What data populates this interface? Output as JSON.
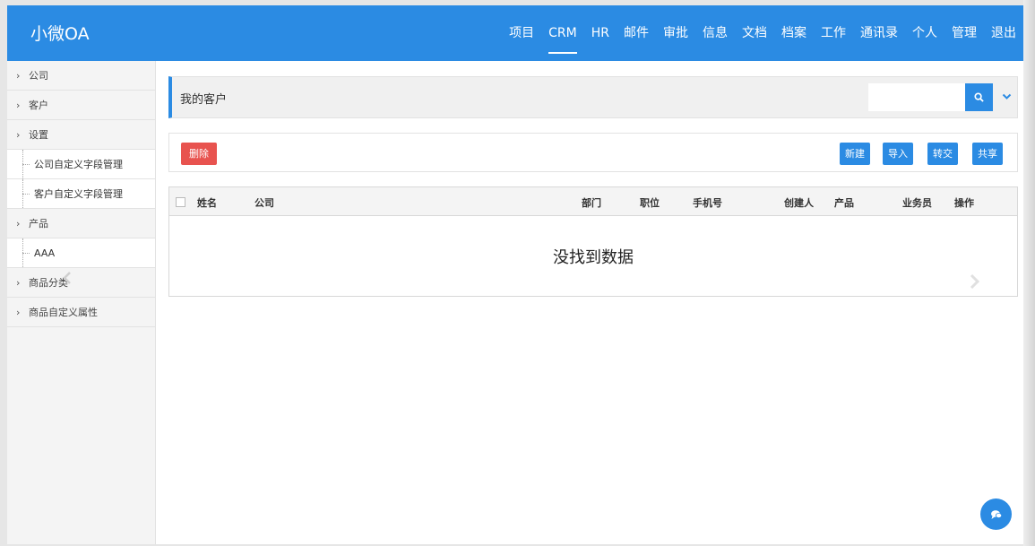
{
  "app": {
    "title": "小微OA"
  },
  "nav": {
    "items": [
      {
        "label": "项目",
        "active": false
      },
      {
        "label": "CRM",
        "active": true
      },
      {
        "label": "HR",
        "active": false
      },
      {
        "label": "邮件",
        "active": false
      },
      {
        "label": "审批",
        "active": false
      },
      {
        "label": "信息",
        "active": false
      },
      {
        "label": "文档",
        "active": false
      },
      {
        "label": "档案",
        "active": false
      },
      {
        "label": "工作",
        "active": false
      },
      {
        "label": "通讯录",
        "active": false
      },
      {
        "label": "个人",
        "active": false
      },
      {
        "label": "管理",
        "active": false
      },
      {
        "label": "退出",
        "active": false
      }
    ]
  },
  "sidebar": {
    "items": [
      {
        "label": "公司",
        "type": "group"
      },
      {
        "label": "客户",
        "type": "group"
      },
      {
        "label": "设置",
        "type": "group"
      },
      {
        "label": "公司自定义字段管理",
        "type": "sub"
      },
      {
        "label": "客户自定义字段管理",
        "type": "sub"
      },
      {
        "label": "产品",
        "type": "group"
      },
      {
        "label": "AAA",
        "type": "sub"
      },
      {
        "label": "商品分类",
        "type": "group"
      },
      {
        "label": "商品自定义属性",
        "type": "group"
      }
    ]
  },
  "header": {
    "title": "我的客户",
    "search_value": "",
    "search_icon": "search-icon",
    "dropdown_icon": "chevron-down-icon"
  },
  "toolbar": {
    "delete_label": "删除",
    "new_label": "新建",
    "import_label": "导入",
    "transfer_label": "转交",
    "share_label": "共享"
  },
  "table": {
    "columns": [
      "姓名",
      "公司",
      "部门",
      "职位",
      "手机号",
      "创建人",
      "产品",
      "业务员",
      "操作"
    ],
    "rows": [],
    "empty_message": "没找到数据"
  },
  "colors": {
    "primary": "#2b8be3",
    "danger": "#e8534f",
    "sidebar_bg": "#f4f4f4"
  }
}
